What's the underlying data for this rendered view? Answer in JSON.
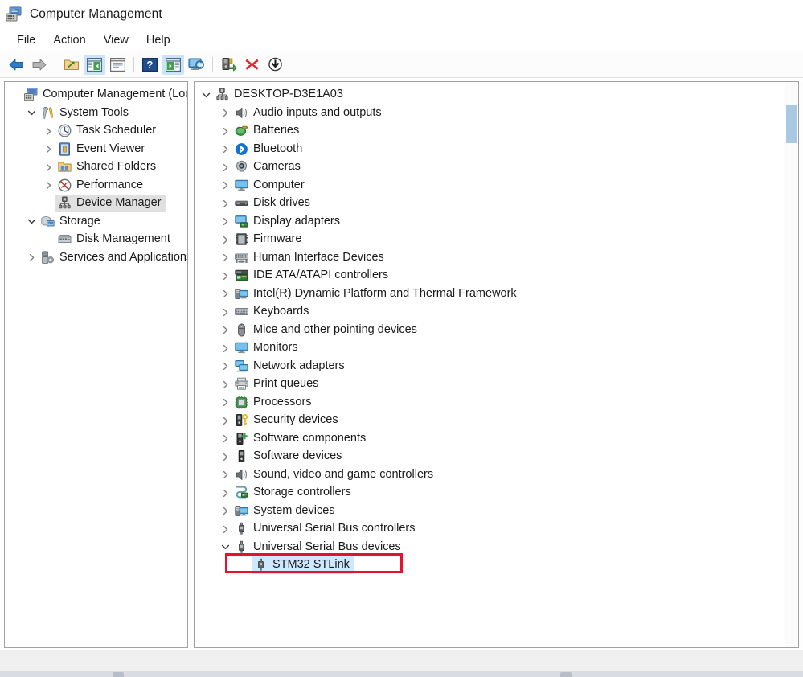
{
  "window": {
    "title": "Computer Management",
    "icon": "computer-management-icon"
  },
  "menubar": {
    "items": [
      {
        "label": "File",
        "name": "menu-file"
      },
      {
        "label": "Action",
        "name": "menu-action"
      },
      {
        "label": "View",
        "name": "menu-view"
      },
      {
        "label": "Help",
        "name": "menu-help"
      }
    ]
  },
  "toolbar": {
    "buttons": [
      {
        "icon": "back-arrow-icon",
        "name": "toolbar-back",
        "active": false
      },
      {
        "icon": "forward-arrow-icon",
        "name": "toolbar-forward",
        "active": false
      },
      {
        "icon": "separator",
        "name": "toolbar-separator-1",
        "active": false
      },
      {
        "icon": "up-folder-icon",
        "name": "toolbar-up-one-level",
        "active": false
      },
      {
        "icon": "show-hide-tree-icon",
        "name": "toolbar-show-hide-tree",
        "active": true
      },
      {
        "icon": "properties-icon",
        "name": "toolbar-properties",
        "active": false
      },
      {
        "icon": "separator",
        "name": "toolbar-separator-2",
        "active": false
      },
      {
        "icon": "help-icon",
        "name": "toolbar-help",
        "active": false
      },
      {
        "icon": "show-hide-action-icon",
        "name": "toolbar-show-hide-action-pane",
        "active": true
      },
      {
        "icon": "scan-hardware-icon",
        "name": "toolbar-scan-hardware",
        "active": false
      },
      {
        "icon": "separator",
        "name": "toolbar-separator-3",
        "active": false
      },
      {
        "icon": "update-driver-icon",
        "name": "toolbar-update-driver",
        "active": false
      },
      {
        "icon": "uninstall-device-icon",
        "name": "toolbar-uninstall-device",
        "active": false
      },
      {
        "icon": "disable-device-icon",
        "name": "toolbar-disable-device",
        "active": false
      }
    ]
  },
  "console_tree": {
    "nodes": [
      {
        "label": "Computer Management (Local)",
        "indent": 0,
        "twisty": "none",
        "icon": "computer-management-icon",
        "state": "normal",
        "name": "tree-computer-management-local"
      },
      {
        "label": "System Tools",
        "indent": 1,
        "twisty": "expanded",
        "icon": "system-tools-icon",
        "state": "normal",
        "name": "tree-system-tools"
      },
      {
        "label": "Task Scheduler",
        "indent": 2,
        "twisty": "collapsed",
        "icon": "clock-icon",
        "state": "normal",
        "name": "tree-task-scheduler"
      },
      {
        "label": "Event Viewer",
        "indent": 2,
        "twisty": "collapsed",
        "icon": "event-viewer-icon",
        "state": "normal",
        "name": "tree-event-viewer"
      },
      {
        "label": "Shared Folders",
        "indent": 2,
        "twisty": "collapsed",
        "icon": "shared-folders-icon",
        "state": "normal",
        "name": "tree-shared-folders"
      },
      {
        "label": "Performance",
        "indent": 2,
        "twisty": "collapsed",
        "icon": "performance-icon",
        "state": "normal",
        "name": "tree-performance"
      },
      {
        "label": "Device Manager",
        "indent": 2,
        "twisty": "none",
        "icon": "device-manager-icon",
        "state": "selected-gray",
        "name": "tree-device-manager"
      },
      {
        "label": "Storage",
        "indent": 1,
        "twisty": "expanded",
        "icon": "storage-icon",
        "state": "normal",
        "name": "tree-storage"
      },
      {
        "label": "Disk Management",
        "indent": 2,
        "twisty": "none",
        "icon": "disk-management-icon",
        "state": "normal",
        "name": "tree-disk-management"
      },
      {
        "label": "Services and Applications",
        "indent": 1,
        "twisty": "collapsed",
        "icon": "services-applications-icon",
        "state": "normal",
        "name": "tree-services-and-applications"
      }
    ]
  },
  "device_tree": {
    "nodes": [
      {
        "label": "DESKTOP-D3E1A03",
        "indent": 0,
        "twisty": "expanded",
        "icon": "computer-root-icon",
        "state": "normal",
        "name": "device-root-desktop"
      },
      {
        "label": "Audio inputs and outputs",
        "indent": 1,
        "twisty": "collapsed",
        "icon": "speaker-icon",
        "state": "normal",
        "name": "device-category-audio-inputs-and-outputs"
      },
      {
        "label": "Batteries",
        "indent": 1,
        "twisty": "collapsed",
        "icon": "battery-icon",
        "state": "normal",
        "name": "device-category-batteries"
      },
      {
        "label": "Bluetooth",
        "indent": 1,
        "twisty": "collapsed",
        "icon": "bluetooth-icon",
        "state": "normal",
        "name": "device-category-bluetooth"
      },
      {
        "label": "Cameras",
        "indent": 1,
        "twisty": "collapsed",
        "icon": "camera-icon",
        "state": "normal",
        "name": "device-category-cameras"
      },
      {
        "label": "Computer",
        "indent": 1,
        "twisty": "collapsed",
        "icon": "monitor-icon",
        "state": "normal",
        "name": "device-category-computer"
      },
      {
        "label": "Disk drives",
        "indent": 1,
        "twisty": "collapsed",
        "icon": "disk-drive-icon",
        "state": "normal",
        "name": "device-category-disk-drives"
      },
      {
        "label": "Display adapters",
        "indent": 1,
        "twisty": "collapsed",
        "icon": "display-adapter-icon",
        "state": "normal",
        "name": "device-category-display-adapters"
      },
      {
        "label": "Firmware",
        "indent": 1,
        "twisty": "collapsed",
        "icon": "firmware-chip-icon",
        "state": "normal",
        "name": "device-category-firmware"
      },
      {
        "label": "Human Interface Devices",
        "indent": 1,
        "twisty": "collapsed",
        "icon": "hid-icon",
        "state": "normal",
        "name": "device-category-human-interface-devices"
      },
      {
        "label": "IDE ATA/ATAPI controllers",
        "indent": 1,
        "twisty": "collapsed",
        "icon": "ide-controller-icon",
        "state": "normal",
        "name": "device-category-ide-ata-atapi-controllers"
      },
      {
        "label": "Intel(R) Dynamic Platform and Thermal Framework",
        "indent": 1,
        "twisty": "collapsed",
        "icon": "system-device-icon",
        "state": "normal",
        "name": "device-category-intel-dynamic-platform-and-thermal-framework"
      },
      {
        "label": "Keyboards",
        "indent": 1,
        "twisty": "collapsed",
        "icon": "keyboard-icon",
        "state": "normal",
        "name": "device-category-keyboards"
      },
      {
        "label": "Mice and other pointing devices",
        "indent": 1,
        "twisty": "collapsed",
        "icon": "mouse-icon",
        "state": "normal",
        "name": "device-category-mice-and-other-pointing-devices"
      },
      {
        "label": "Monitors",
        "indent": 1,
        "twisty": "collapsed",
        "icon": "monitor-icon",
        "state": "normal",
        "name": "device-category-monitors"
      },
      {
        "label": "Network adapters",
        "indent": 1,
        "twisty": "collapsed",
        "icon": "network-adapter-icon",
        "state": "normal",
        "name": "device-category-network-adapters"
      },
      {
        "label": "Print queues",
        "indent": 1,
        "twisty": "collapsed",
        "icon": "printer-icon",
        "state": "normal",
        "name": "device-category-print-queues"
      },
      {
        "label": "Processors",
        "indent": 1,
        "twisty": "collapsed",
        "icon": "processor-icon",
        "state": "normal",
        "name": "device-category-processors"
      },
      {
        "label": "Security devices",
        "indent": 1,
        "twisty": "collapsed",
        "icon": "security-device-icon",
        "state": "normal",
        "name": "device-category-security-devices"
      },
      {
        "label": "Software components",
        "indent": 1,
        "twisty": "collapsed",
        "icon": "software-component-icon",
        "state": "normal",
        "name": "device-category-software-components"
      },
      {
        "label": "Software devices",
        "indent": 1,
        "twisty": "collapsed",
        "icon": "software-device-icon",
        "state": "normal",
        "name": "device-category-software-devices"
      },
      {
        "label": "Sound, video and game controllers",
        "indent": 1,
        "twisty": "collapsed",
        "icon": "speaker-icon",
        "state": "normal",
        "name": "device-category-sound-video-and-game-controllers"
      },
      {
        "label": "Storage controllers",
        "indent": 1,
        "twisty": "collapsed",
        "icon": "storage-controller-icon",
        "state": "normal",
        "name": "device-category-storage-controllers"
      },
      {
        "label": "System devices",
        "indent": 1,
        "twisty": "collapsed",
        "icon": "system-device-icon",
        "state": "normal",
        "name": "device-category-system-devices"
      },
      {
        "label": "Universal Serial Bus controllers",
        "indent": 1,
        "twisty": "collapsed",
        "icon": "usb-icon",
        "state": "normal",
        "name": "device-category-universal-serial-bus-controllers"
      },
      {
        "label": "Universal Serial Bus devices",
        "indent": 1,
        "twisty": "expanded",
        "icon": "usb-icon",
        "state": "normal",
        "name": "device-category-universal-serial-bus-devices"
      },
      {
        "label": "STM32 STLink",
        "indent": 2,
        "twisty": "none",
        "icon": "usb-icon",
        "state": "selected-blue",
        "name": "device-item-stm32-stlink"
      }
    ]
  },
  "annotation": {
    "target": "STM32 STLink",
    "color": "#e8112d",
    "shape": "rectangle"
  },
  "scrollbar": {
    "orientation": "vertical",
    "thumb_color": "#a8c8e4"
  },
  "colors": {
    "selection_blue": "#cde8ff",
    "selection_gray": "#e0e0e0",
    "annotation_red": "#e8112d",
    "toolbar_active": "#cce4f7",
    "panel_border": "#a0a0a0"
  }
}
